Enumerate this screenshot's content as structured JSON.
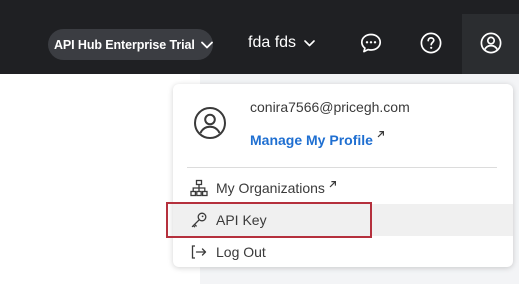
{
  "topbar": {
    "trial_label": "API Hub Enterprise Trial",
    "org_label": "fda fds"
  },
  "profile_menu": {
    "email": "conira7566@pricegh.com",
    "manage_profile_label": "Manage My Profile",
    "items": [
      {
        "label": "My Organizations",
        "icon": "sitemap-icon",
        "external": true
      },
      {
        "label": "API Key",
        "icon": "key-icon",
        "external": false
      },
      {
        "label": "Log Out",
        "icon": "logout-icon",
        "external": false
      }
    ]
  },
  "colors": {
    "topbar_bg": "#1f2023",
    "link_blue": "#1f6fd1",
    "callout_red": "#b5303d",
    "hover_bg": "#f0f0f0"
  }
}
